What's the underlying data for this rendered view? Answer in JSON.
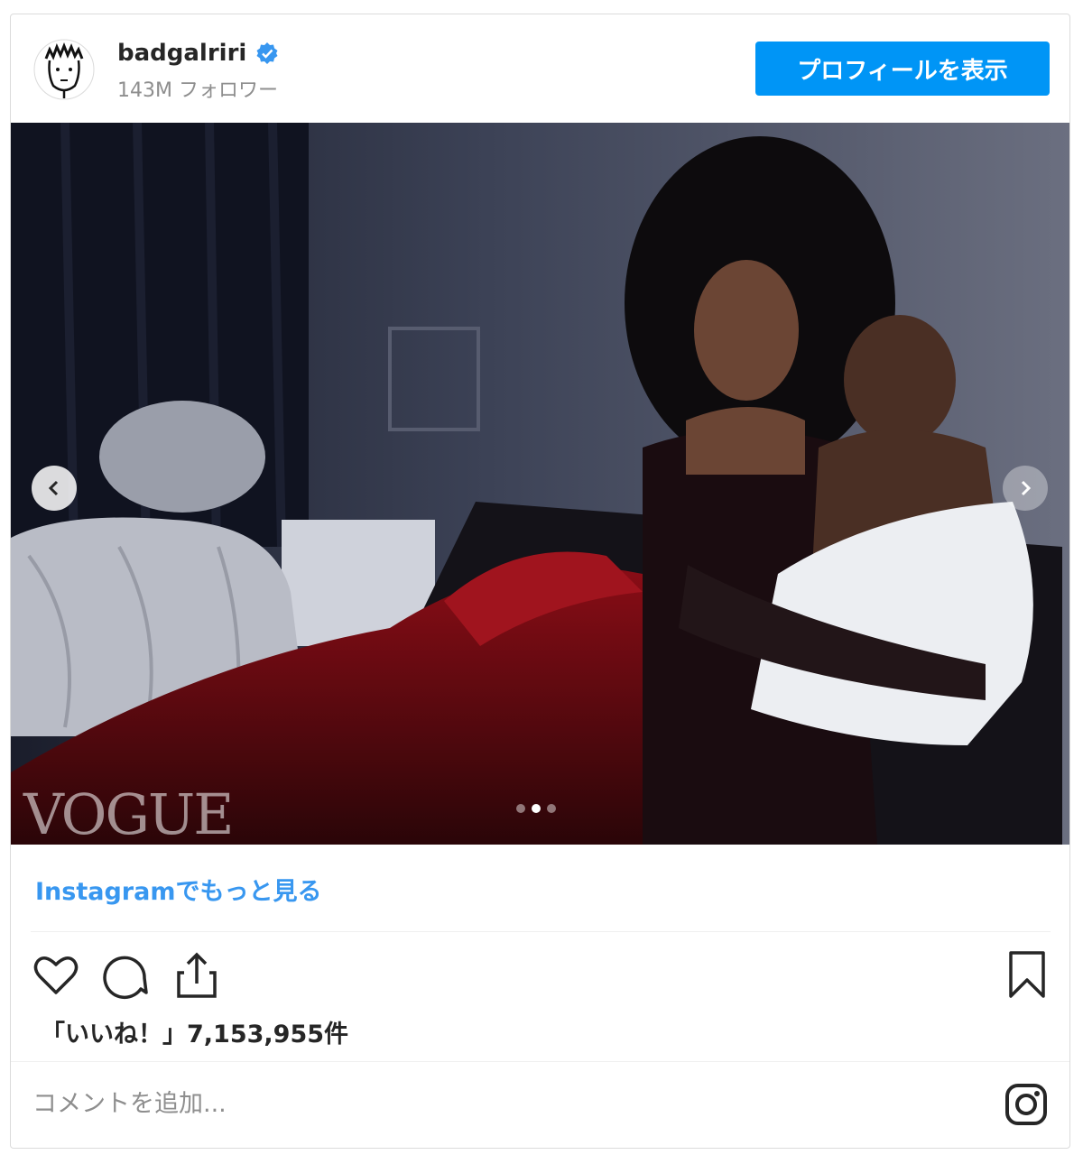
{
  "header": {
    "username": "badgalriri",
    "verified_icon": "verified-badge-icon",
    "followers": "143M フォロワー",
    "profile_button": "プロフィールを表示"
  },
  "photo": {
    "watermark": "VOGUE",
    "carousel": {
      "total": 3,
      "active_index": 1
    }
  },
  "more_link": "Instagramでもっと見る",
  "actions": {
    "like_icon": "heart-icon",
    "comment_icon": "comment-icon",
    "share_icon": "share-icon",
    "save_icon": "bookmark-icon"
  },
  "likes": "「いいね！」7,153,955件",
  "comment": {
    "placeholder": "コメントを追加..."
  },
  "colors": {
    "accent": "#0095f6",
    "link": "#3897f0",
    "border": "#dbdbdb"
  }
}
